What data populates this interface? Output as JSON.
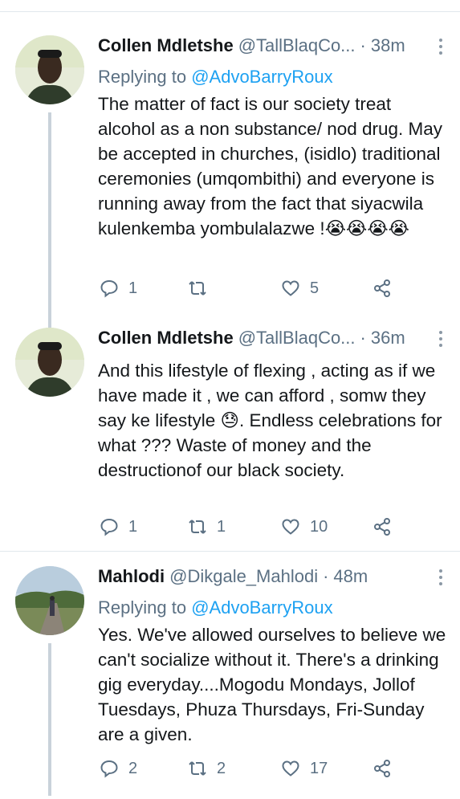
{
  "tweets": [
    {
      "name": "Collen Mdletshe",
      "handle": "@TallBlaqCo...",
      "time": "38m",
      "reply_to_prefix": "Replying to",
      "reply_to": "@AdvoBarryRoux",
      "text": "The matter of fact is our society treat alcohol as a non substance/ nod drug. May be accepted in churches, (isidlo) traditional ceremonies (umqombithi) and everyone is running away from the fact that siyacwila kulenkemba yombulalazwe !😭😭😭😭",
      "replies": "1",
      "retweets": "",
      "likes": "5"
    },
    {
      "name": "Collen Mdletshe",
      "handle": "@TallBlaqCo...",
      "time": "36m",
      "text": "And this lifestyle of flexing , acting as if we have made it , we can afford , somw they say ke lifestyle 😓. Endless celebrations for what ???  Waste of money and the destructionof our black society.",
      "replies": "1",
      "retweets": "1",
      "likes": "10"
    },
    {
      "name": "Mahlodi",
      "handle": "@Dikgale_Mahlodi",
      "time": "48m",
      "reply_to_prefix": "Replying to",
      "reply_to": "@AdvoBarryRoux",
      "text": "Yes. We've allowed ourselves to believe we can't socialize without it. There's a drinking gig everyday....Mogodu Mondays, Jollof Tuesdays,  Phuza Thursdays, Fri-Sunday are a given.",
      "replies": "2",
      "retweets": "2",
      "likes": "17"
    }
  ],
  "separator_dot": "·",
  "colors": {
    "text": "#14171a",
    "secondary": "#5b7083",
    "link": "#1da1f2",
    "divider": "#e1e8ed",
    "thread_line": "#c9d2da"
  },
  "icons": [
    "reply-icon",
    "retweet-icon",
    "like-icon",
    "share-icon",
    "more-icon"
  ]
}
